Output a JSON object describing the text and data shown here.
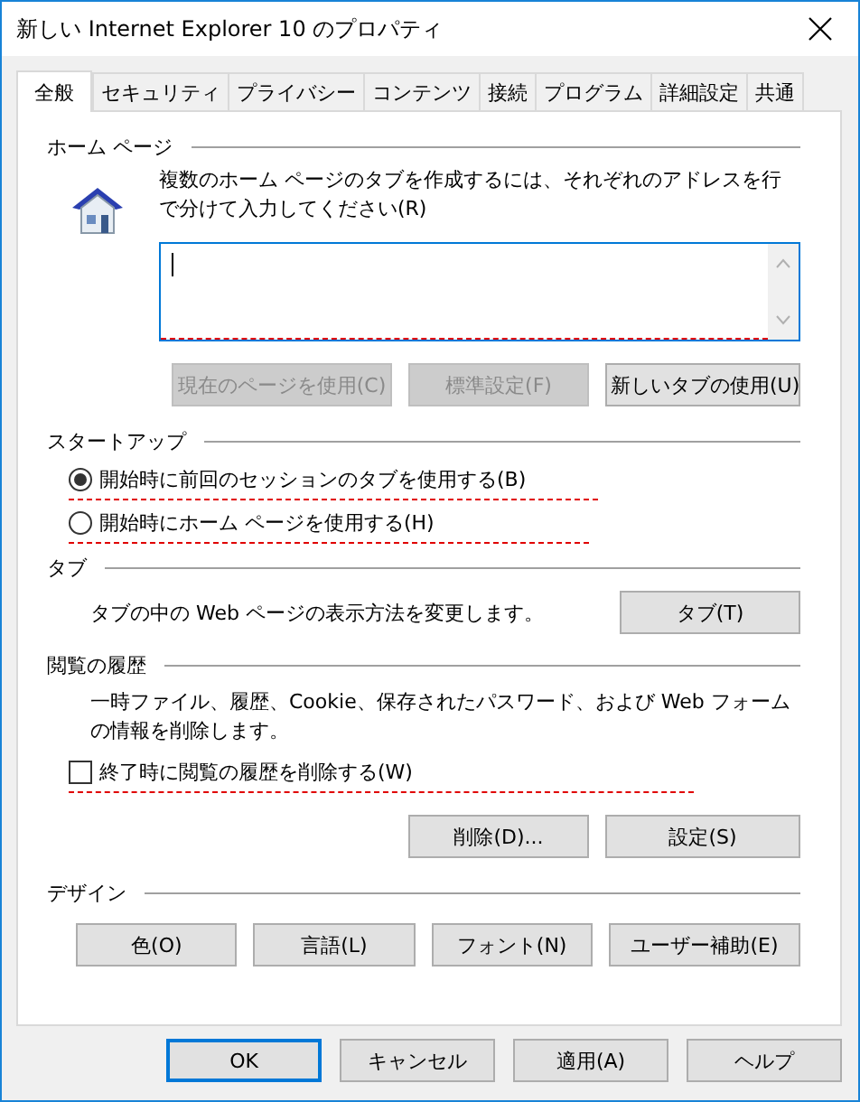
{
  "window": {
    "title": "新しい Internet Explorer 10 のプロパティ"
  },
  "tabs": [
    {
      "label": "全般",
      "selected": true
    },
    {
      "label": "セキュリティ",
      "selected": false
    },
    {
      "label": "プライバシー",
      "selected": false
    },
    {
      "label": "コンテンツ",
      "selected": false
    },
    {
      "label": "接続",
      "selected": false
    },
    {
      "label": "プログラム",
      "selected": false
    },
    {
      "label": "詳細設定",
      "selected": false
    },
    {
      "label": "共通",
      "selected": false
    }
  ],
  "home_page": {
    "heading": "ホーム ページ",
    "description": "複数のホーム ページのタブを作成するには、それぞれのアドレスを行で分けて入力してください(R)",
    "flagged": true,
    "buttons": [
      {
        "label": "現在のページを使用(C)",
        "disabled": true
      },
      {
        "label": "標準設定(F)",
        "disabled": true
      },
      {
        "label": "新しいタブの使用(U)",
        "disabled": false
      }
    ]
  },
  "startup": {
    "heading": "スタートアップ",
    "options": [
      {
        "label": "開始時に前回のセッションのタブを使用する(B)",
        "selected": true,
        "flagged": true
      },
      {
        "label": "開始時にホーム ページを使用する(H)",
        "selected": false,
        "flagged": true
      }
    ]
  },
  "tab_settings": {
    "heading": "タブ",
    "description": "タブの中の Web ページの表示方法を変更します。",
    "button": "タブ(T)"
  },
  "history": {
    "heading": "閲覧の履歴",
    "description": "一時ファイル、履歴、Cookie、保存されたパスワード、および Web フォームの情報を削除します。",
    "checkbox": {
      "label": "終了時に閲覧の履歴を削除する(W)",
      "checked": false,
      "flagged": true
    },
    "buttons": [
      "削除(D)...",
      "設定(S)"
    ]
  },
  "design": {
    "heading": "デザイン",
    "buttons": [
      "色(O)",
      "言語(L)",
      "フォント(N)",
      "ユーザー補助(E)"
    ]
  },
  "footer_buttons": [
    {
      "label": "OK",
      "default": true
    },
    {
      "label": "キャンセル",
      "default": false
    },
    {
      "label": "適用(A)",
      "default": false
    },
    {
      "label": "ヘルプ",
      "default": false
    }
  ]
}
